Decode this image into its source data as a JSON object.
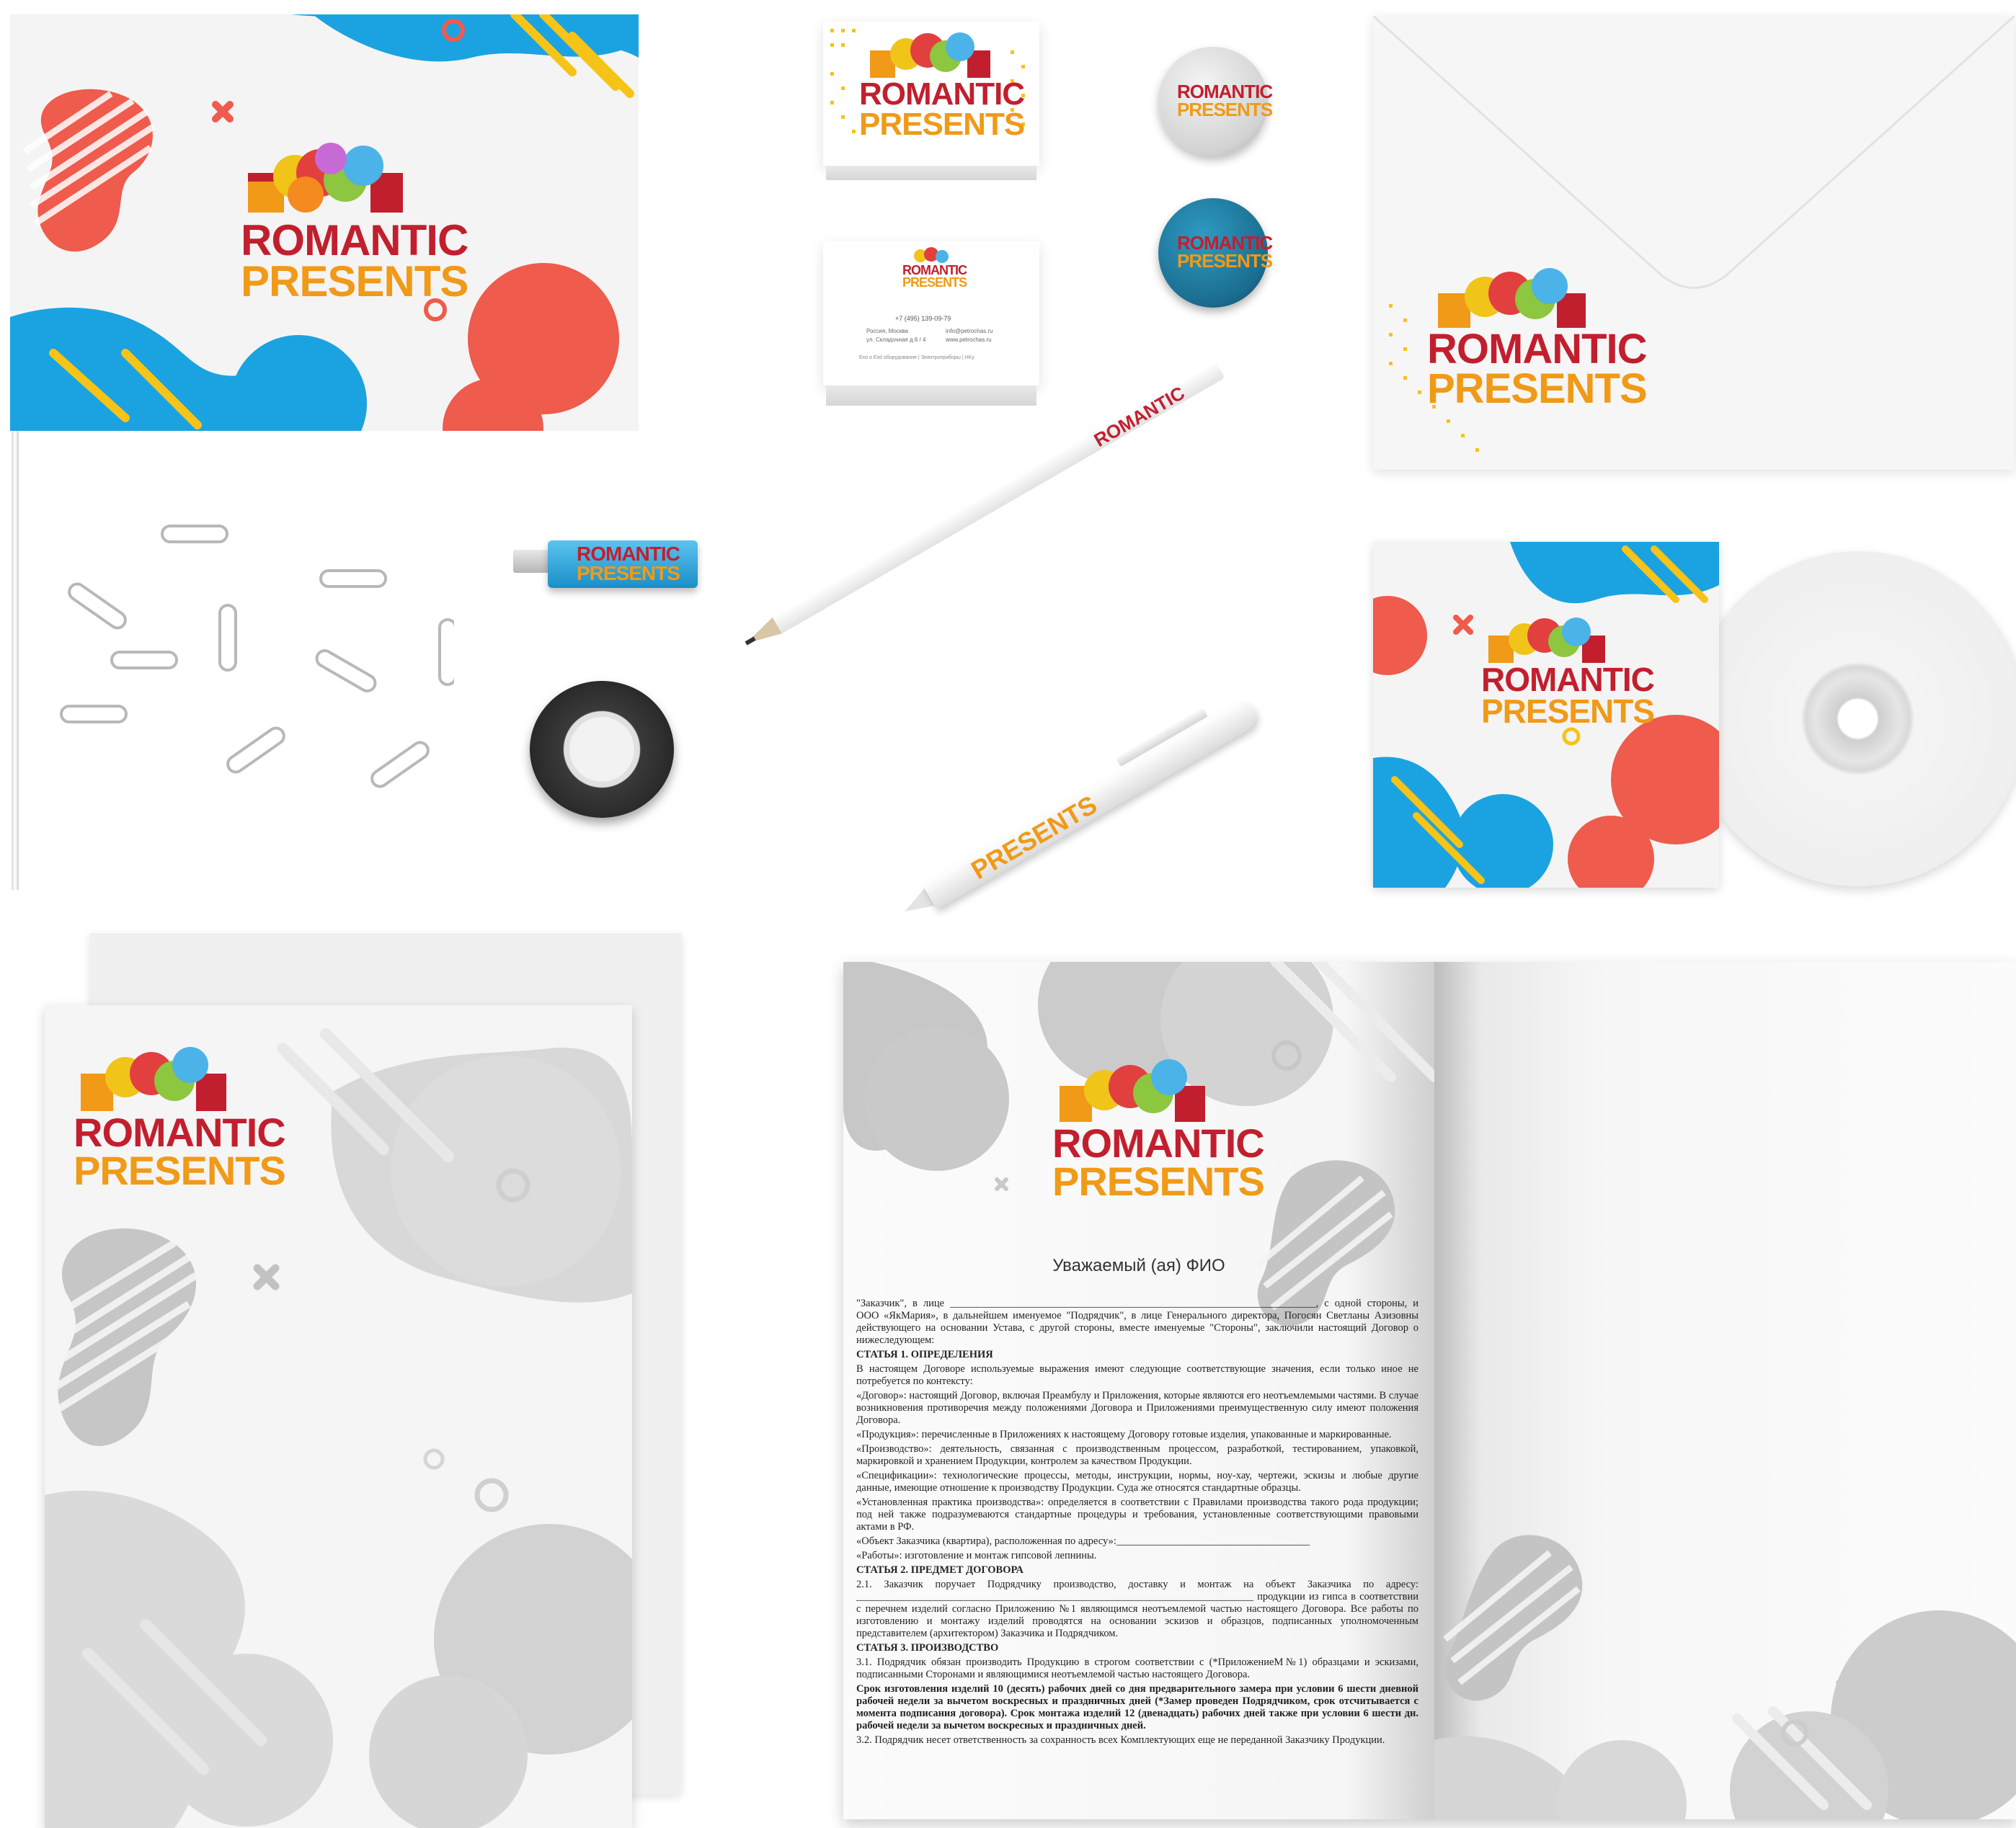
{
  "brand": {
    "line1": "ROMANTIC",
    "line2": "PRESENTS",
    "colors": {
      "red": "#c21f2e",
      "orange": "#f09a17",
      "blue": "#1aa3e0",
      "coral": "#ef5b4c",
      "yellow": "#f6c318",
      "grey": "#c9c9c9"
    }
  },
  "pencil": {
    "text": "ROMANTIC"
  },
  "pen": {
    "text": "PRESENTS"
  },
  "usb": {
    "line1": "ROMANTIC",
    "line2": "PRESENTS"
  },
  "business_card": {
    "phone": "+7 (495) 139-09-79",
    "address_line1": "Россия, Москва",
    "address_line2": "ул. Складочная д.6 / 4",
    "email": "info@petrochas.ru",
    "site": "www.petrochas.ru",
    "footer": "Exo и Exd оборудование | Электроприборы | HKy"
  },
  "letter": {
    "greeting": "Уважаемый (ая) ФИО",
    "p1": "\"Заказчик\", в лице ______________________________________________________________________, с одной стороны, и ООО «ЯкМария», в дальнейшем именуемое \"Подрядчик\", в лице Генерального директора, Погосян Светланы Азизовны действующего на основании Устава, с другой стороны, вместе именуемые \"Стороны\", заключили настоящий Договор о нижеследующем:",
    "h1": "СТАТЬЯ 1. ОПРЕДЕЛЕНИЯ",
    "p2": "В настоящем Договоре используемые выражения имеют следующие соответствующие значения, если только иное не потребуется по контексту:",
    "p3": "«Договор»: настоящий Договор, включая Преамбулу и Приложения, которые являются его неотъемлемыми частями. В случае возникновения противоречия между положениями Договора и Приложениями преимущественную силу имеют положения Договора.",
    "p4": "«Продукция»: перечисленные в Приложениях к настоящему Договору готовые изделия, упакованные и маркированные.",
    "p5": "«Производство»: деятельность, связанная с производственным процессом, разработкой, тестированием, упаковкой, маркировкой и хранением Продукции, контролем за качеством Продукции.",
    "p6": "«Спецификации»: технологические процессы, методы, инструкции, нормы, ноу-хау, чертежи, эскизы и любые другие данные, имеющие отношение к производству Продукции. Суда же относятся стандартные образцы.",
    "p7": "«Установленная практика производства»: определяется в соответствии с Правилами производства такого рода продукции; под ней также подразумеваются стандартные процедуры и требования, установленные соответствующими правовыми актами в РФ.",
    "p8": "«Объект Заказчика (квартира), расположенная по адресу»:_____________________________________",
    "p9": "«Работы»: изготовление и монтаж гипсовой лепнины.",
    "h2": "СТАТЬЯ 2. ПРЕДМЕТ ДОГОВОРА",
    "p10": "2.1. Заказчик поручает Подрядчику производство, доставку и монтаж на объект Заказчика по адресу: ____________________________________________________________________________ продукции из гипса в соответствии с перечнем изделий согласно Приложению №1 являющимся неотъемлемой частью настоящего Договора. Все работы по изготовлению и монтажу изделий проводятся на основании эскизов и образцов, подписанных уполномоченным представителем (архитектором) Заказчика и Подрядчиком.",
    "h3": "СТАТЬЯ 3. ПРОИЗВОДСТВО",
    "p11": "3.1. Подрядчик обязан производить Продукцию в строгом соответствии с (*ПриложениеМ№1) образцами и эскизами, подписанными Сторонами и являющимися неотъемлемой частью настоящего Договора.",
    "p12": "Срок изготовления изделий 10 (десять) рабочих дней со дня предварительного замера при условии 6 шести дневной рабочей недели за вычетом воскресных и праздничных дней (*Замер проведен Подрядчиком, срок отсчитывается с момента подписания договора). Срок монтажа изделий 12 (двенадцать) рабочих дней также при условии 6 шести дн. рабочей недели за вычетом воскресных и праздничных дней.",
    "p13": "3.2. Подрядчик несет ответственность за сохранность всех Комплектующих еще не переданной Заказчику Продукции."
  }
}
